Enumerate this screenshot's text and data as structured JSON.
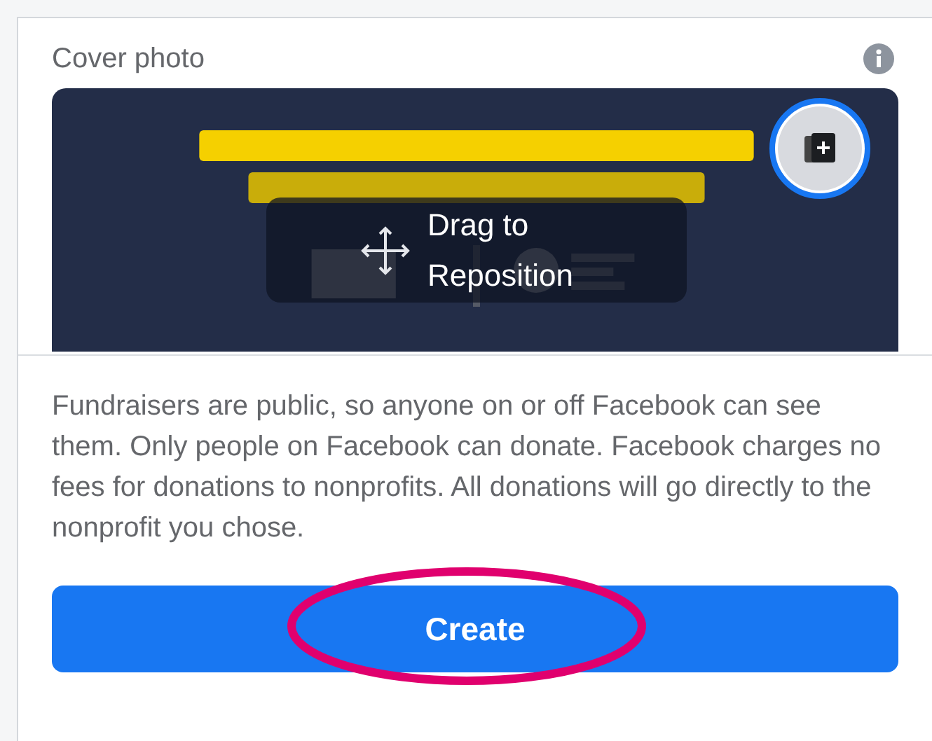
{
  "section": {
    "title": "Cover photo"
  },
  "cover": {
    "kind": "picture",
    "overlay_label": "Drag to Reposition"
  },
  "notice": "Fundraisers are public, so anyone on or off Facebook can see them. Only people on Facebook can donate. Facebook charges no fees for donations to nonprofits. All donations will go directly to the nonprofit you chose.",
  "button": {
    "label": "Create",
    "circled": true
  }
}
